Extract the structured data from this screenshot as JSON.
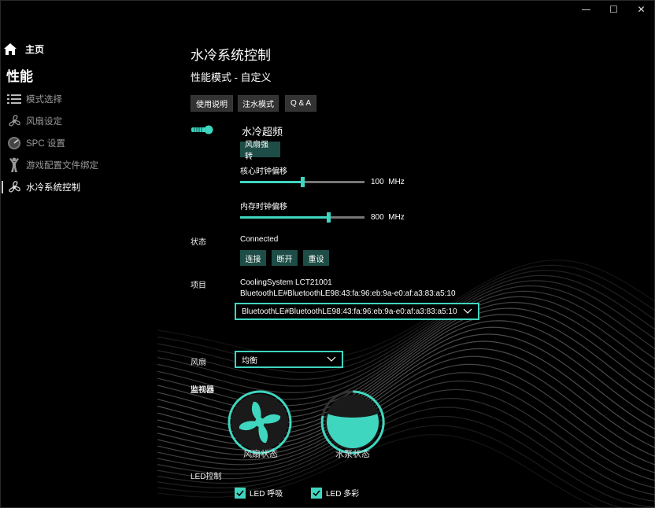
{
  "window": {
    "minimize": "—",
    "maximize": "☐",
    "close": "✕"
  },
  "sidebar": {
    "home_label": "主页",
    "section_title": "性能",
    "items": [
      {
        "label": "模式选择",
        "icon": "list-icon"
      },
      {
        "label": "风扇设定",
        "icon": "fan-icon"
      },
      {
        "label": "SPC 设置",
        "icon": "spc-icon"
      },
      {
        "label": "游戏配置文件绑定",
        "icon": "game-figure-icon"
      },
      {
        "label": "水冷系统控制",
        "icon": "fan-icon"
      }
    ]
  },
  "main": {
    "title": "水冷系统控制",
    "subtitle": "性能模式 - 自定义",
    "buttons": {
      "manual": "使用说明",
      "fill_water": "注水模式",
      "qa": "Q & A"
    },
    "overclock": {
      "title": "水冷超频",
      "fan_boost": "风扇强转",
      "core_label": "核心时钟偏移",
      "core_value": "100",
      "core_unit": "MHz",
      "core_fraction": 0.5,
      "mem_label": "内存时钟偏移",
      "mem_value": "800",
      "mem_unit": "MHz",
      "mem_fraction": 0.71
    },
    "status": {
      "label": "状态",
      "value": "Connected",
      "connect": "连接",
      "disconnect": "断开",
      "reset": "重设"
    },
    "project": {
      "label": "项目",
      "line1": "CoolingSystem LCT21001",
      "line2": "BluetoothLE#BluetoothLE98:43:fa:96:eb:9a-e0:af:a3:83:a5:10",
      "selected": "BluetoothLE#BluetoothLE98:43:fa:96:eb:9a-e0:af:a3:83:a5:10"
    },
    "fan": {
      "label": "风扇",
      "selected": "均衡"
    },
    "monitor": {
      "label": "监视器",
      "fan_status": "风扇状态",
      "pump_status": "水泵状态"
    },
    "led": {
      "label": "LED控制",
      "breath": "LED 呼吸",
      "multicolor": "LED 多彩"
    }
  },
  "colors": {
    "accent": "#3fd6bf",
    "button_dark": "#333333",
    "button_teal": "#1e4c46"
  }
}
